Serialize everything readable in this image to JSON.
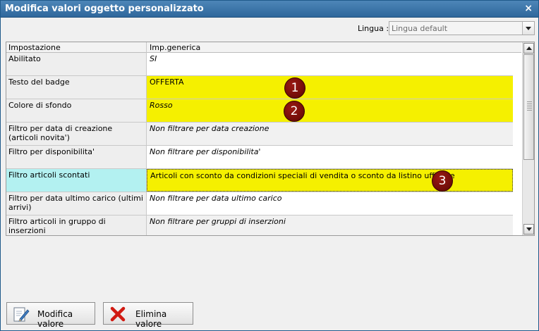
{
  "window": {
    "title": "Modifica valori oggetto personalizzato",
    "close_glyph": "×"
  },
  "language": {
    "label": "Lingua :",
    "value": "Lingua default"
  },
  "grid": {
    "headers": [
      "Impostazione",
      "Imp.generica"
    ],
    "rows": [
      {
        "setting": "Abilitato",
        "value": "SI"
      },
      {
        "setting": "Testo del badge",
        "value": "OFFERTA",
        "highlight": "#f5f000"
      },
      {
        "setting": "Colore di sfondo",
        "value": "Rosso",
        "highlight": "#f5f000"
      },
      {
        "setting": "Filtro per data di creazione (articoli novita')",
        "value": "Non filtrare per data creazione"
      },
      {
        "setting": "Filtro per disponibilita'",
        "value": "Non filtrare per disponibilita'"
      },
      {
        "setting": "Filtro articoli scontati",
        "value": "Articoli con sconto da condizioni speciali di vendita o sconto da listino ufficiale",
        "highlight": "#f5f000",
        "selected": true
      },
      {
        "setting": "Filtro per data ultimo carico (ultimi arrivi)",
        "value": "Non filtrare per data ultimo carico"
      },
      {
        "setting": "Filtro articoli in gruppo di inserzioni",
        "value": "Non filtrare per gruppi di inserzioni"
      }
    ]
  },
  "callouts": [
    "1",
    "2",
    "3"
  ],
  "buttons": {
    "edit": "Modifica valore",
    "delete": "Elimina valore"
  },
  "colors": {
    "titlebar": "#3f78ab",
    "highlight": "#f5f000",
    "selected_setting": "#b3f1f1",
    "callout": "#7a0f0a"
  },
  "icons": {
    "edit": "pencil-document-icon",
    "delete": "red-x-icon",
    "close": "close-icon",
    "dropdown": "chevron-down-icon"
  }
}
